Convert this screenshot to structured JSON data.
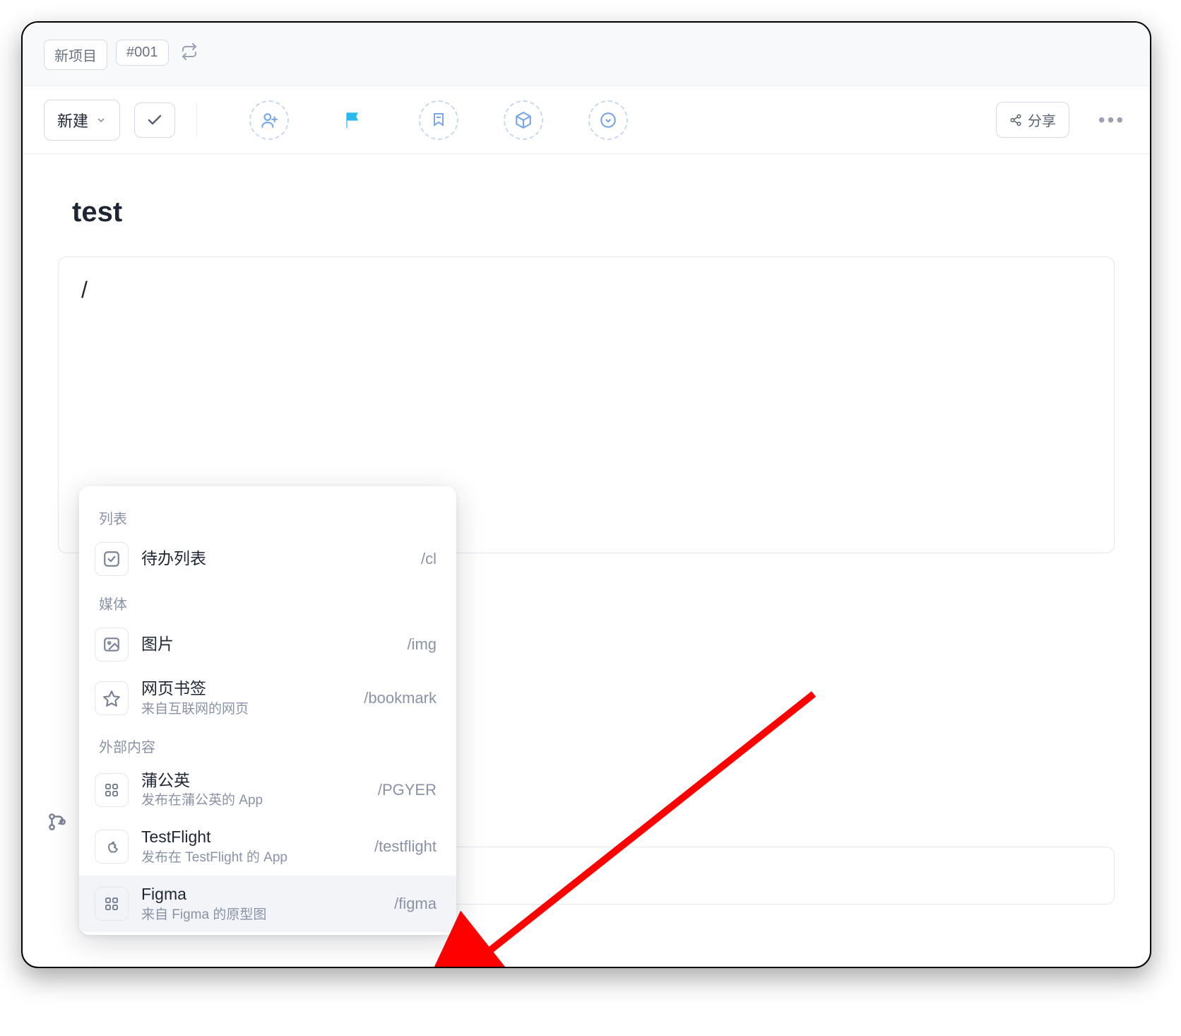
{
  "breadcrumb": {
    "project": "新项目",
    "id": "#001"
  },
  "toolbar": {
    "new_label": "新建",
    "share_label": "分享"
  },
  "page": {
    "title": "test",
    "editor_value": "/"
  },
  "dropdown": {
    "sections": {
      "list": "列表",
      "media": "媒体",
      "external": "外部内容"
    },
    "items": {
      "todo": {
        "label": "待办列表",
        "shortcut": "/cl"
      },
      "image": {
        "label": "图片",
        "shortcut": "/img"
      },
      "bookmark": {
        "label": "网页书签",
        "desc": "来自互联网的网页",
        "shortcut": "/bookmark"
      },
      "pgyer": {
        "label": "蒲公英",
        "desc": "发布在蒲公英的 App",
        "shortcut": "/PGYER"
      },
      "testflight": {
        "label": "TestFlight",
        "desc": "发布在 TestFlight 的 App",
        "shortcut": "/testflight"
      },
      "figma": {
        "label": "Figma",
        "desc": "来自 Figma 的原型图",
        "shortcut": "/figma"
      }
    }
  }
}
